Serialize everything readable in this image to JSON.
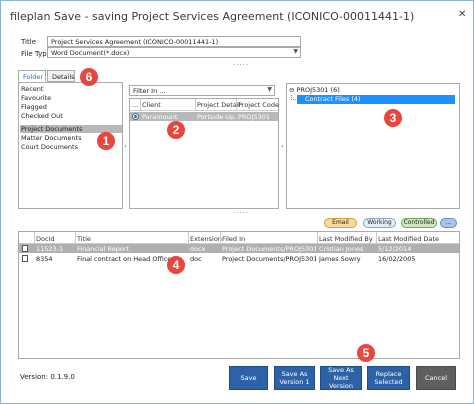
{
  "window": {
    "title": "fileplan Save - saving Project Services Agreement (ICONICO-00011441-1)",
    "close_glyph": "✕"
  },
  "form": {
    "title_label": "Title",
    "title_value": "Project Services Agreement (ICONICO-00011441-1)",
    "filetype_label": "File Type",
    "filetype_value": "Word Document(*.docx)",
    "splitter_glyph": "....."
  },
  "tabs": [
    {
      "label": "Folder"
    },
    {
      "label": "Details"
    }
  ],
  "folder_list": [
    {
      "label": "Recent"
    },
    {
      "label": "Favourite"
    },
    {
      "label": "Flagged"
    },
    {
      "label": "Checked Out"
    },
    {
      "label": "Project Documents",
      "selected": true
    },
    {
      "label": "Matter Documents"
    },
    {
      "label": "Court Documents"
    }
  ],
  "filter": {
    "value": "Filter In ..."
  },
  "client_table": {
    "headers": [
      "...",
      "Client",
      "Project Detail",
      "Project Code"
    ],
    "rows": [
      {
        "client": "Paramount",
        "detail": "Portside Up...",
        "code": "PROJ5301"
      }
    ]
  },
  "tree": {
    "root": "PROJ5301 (6)",
    "child": "Contract Files (4)"
  },
  "status_pills": [
    {
      "label": "Email",
      "bg": "#f8d9a0",
      "border": "#d9a040"
    },
    {
      "label": "Working",
      "bg": "#e4ecf6",
      "border": "#8aa6c8"
    },
    {
      "label": "Controlled",
      "bg": "#cfe8c0",
      "border": "#6fa650"
    },
    {
      "label": "...",
      "bg": "#a9c3ef",
      "border": "#6a8cc8"
    }
  ],
  "docs_table": {
    "headers": [
      "DocId",
      "Title",
      "Extension",
      "Filed In",
      "Last Modified By",
      "Last Modified Date"
    ],
    "rows": [
      {
        "docid": "11523-1",
        "title": "Financial Report",
        "ext": "docx",
        "filed": "Project Documents/PROJ5301/P...",
        "by": "Cristian Jones",
        "date": "5/12/2014",
        "selected": true
      },
      {
        "docid": "8354",
        "title": "Final contract on Head Office",
        "ext": "doc",
        "filed": "Project Documents/PROJ5301/P...",
        "by": "James Sowry",
        "date": "16/02/2005",
        "selected": false
      }
    ]
  },
  "buttons": {
    "save": "Save",
    "save_as_version_1": "Save As",
    "save_as_version_2": "Version 1",
    "save_next_1": "Save As Next",
    "save_next_2": "Version",
    "replace_1": "Replace",
    "replace_2": "Selected",
    "cancel": "Cancel"
  },
  "version": "Version: 0.1.9.0",
  "badges": [
    "1",
    "2",
    "3",
    "4",
    "5",
    "6"
  ],
  "colors": {
    "accent": "#2e62a8",
    "tree_select": "#1e90ff",
    "badge": "#e8473e"
  }
}
